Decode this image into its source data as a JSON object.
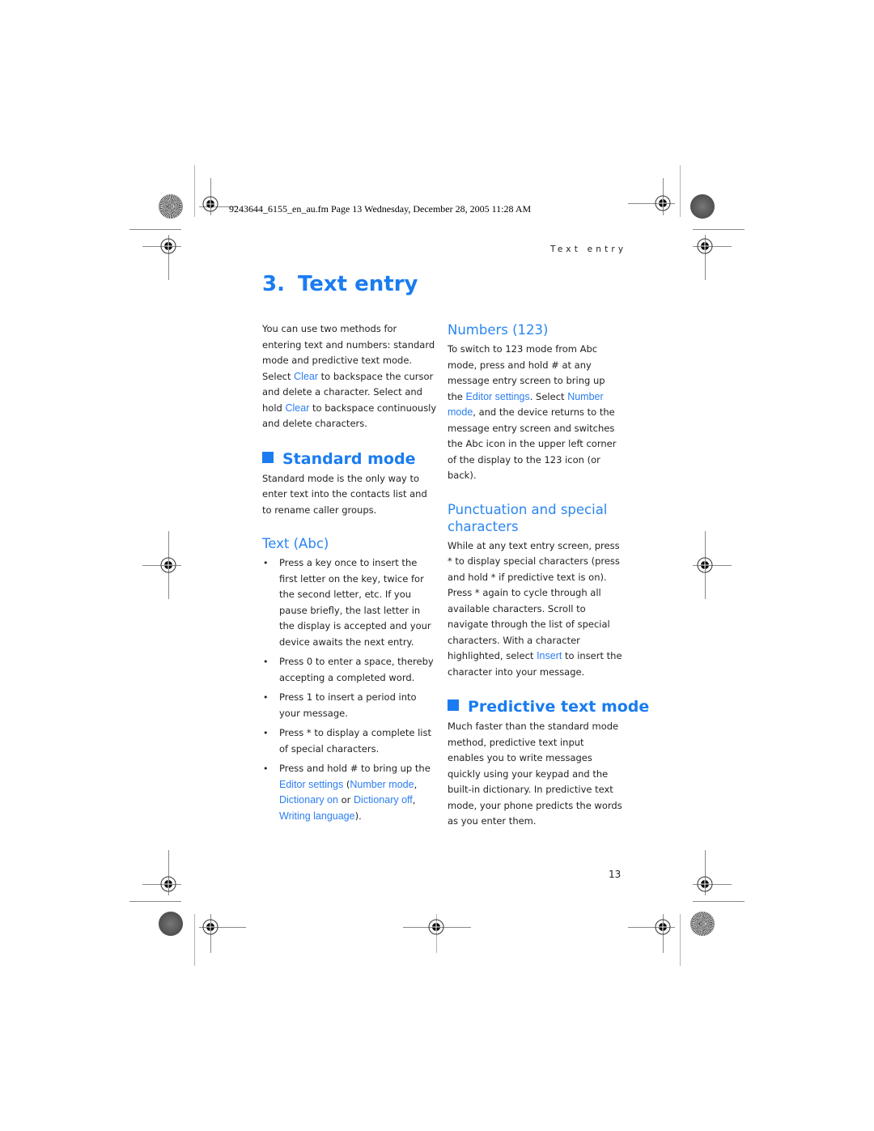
{
  "slug": "9243644_6155_en_au.fm  Page 13  Wednesday, December 28, 2005  11:28 AM",
  "running_header": "Text entry",
  "chapter": {
    "number": "3.",
    "title": "Text entry"
  },
  "intro": {
    "t1": "You can use two methods for entering text and numbers: standard mode and predictive text mode. Select ",
    "k1": "Clear",
    "t2": " to backspace the cursor and delete a character. Select and hold ",
    "k2": "Clear",
    "t3": " to backspace continuously and delete characters."
  },
  "standard_mode": {
    "heading": "Standard mode",
    "body": "Standard mode is the only way to enter text into the contacts list and to rename caller groups."
  },
  "text_abc": {
    "heading": "Text (Abc)",
    "bullets": [
      "Press a key once to insert the first letter on the key, twice for the second letter, etc. If you pause briefly, the last letter in the display is accepted and your device awaits the next entry.",
      "Press 0 to enter a space, thereby accepting a completed word.",
      "Press 1 to insert a period into your message.",
      "Press * to display a complete list of special characters."
    ],
    "last_bullet": {
      "t1": "Press and hold # to bring up the ",
      "k1": "Editor settings",
      "t2": " (",
      "k2": "Number mode",
      "t3": ", ",
      "k3": "Dictionary on",
      "t4": " or ",
      "k4": "Dictionary off",
      "t5": ", ",
      "k5": "Writing language",
      "t6": ")."
    },
    "bullet_glyph": "•"
  },
  "numbers": {
    "heading": "Numbers (123)",
    "t1": "To switch to 123 mode from Abc mode, press and hold # at any message entry screen to bring up the ",
    "k1": "Editor settings",
    "t2": ". Select ",
    "k2": "Number mode",
    "t3": ", and the device returns to the message entry screen and switches the Abc icon in the upper left corner of the display to the 123 icon (or back)."
  },
  "punctuation": {
    "heading": "Punctuation and special characters",
    "t1": "While at any text entry screen, press * to display special characters (press and hold * if predictive text is on). Press * again to cycle through all available characters. Scroll to navigate through the list of special characters. With a character highlighted, select ",
    "k1": "Insert",
    "t2": " to insert the character into your message."
  },
  "predictive": {
    "heading": "Predictive text mode",
    "body": "Much faster than the standard mode method, predictive text input enables you to write messages quickly using your keypad and the built-in dictionary. In predictive text mode, your phone predicts the words as you enter them."
  },
  "page_number": "13",
  "colors": {
    "heading_blue": "#1a7cf0",
    "keyword_blue": "#2b7ef0",
    "body_text": "#222222"
  }
}
